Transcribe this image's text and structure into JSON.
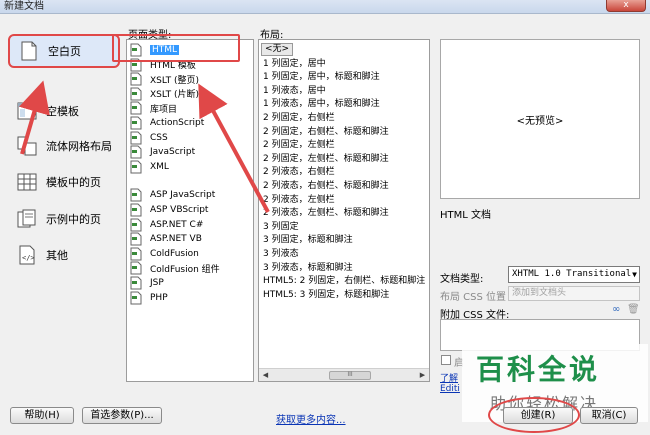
{
  "window": {
    "title": "新建文档",
    "close_label": "x"
  },
  "categories": [
    {
      "label": "空白页",
      "icon": "blank-page-icon",
      "selected": true
    },
    {
      "label": "空模板",
      "icon": "blank-template-icon",
      "selected": false
    },
    {
      "label": "流体网格布局",
      "icon": "fluid-grid-icon",
      "selected": false
    },
    {
      "label": "模板中的页",
      "icon": "page-from-template-icon",
      "selected": false
    },
    {
      "label": "示例中的页",
      "icon": "page-from-sample-icon",
      "selected": false
    },
    {
      "label": "其他",
      "icon": "other-icon",
      "selected": false
    }
  ],
  "page_type": {
    "label": "页面类型:",
    "items": [
      {
        "label": "HTML",
        "selected": true
      },
      {
        "label": "HTML 模板"
      },
      {
        "label": "XSLT (整页)"
      },
      {
        "label": "XSLT (片断)"
      },
      {
        "label": "库项目"
      },
      {
        "label": "ActionScript"
      },
      {
        "label": "CSS"
      },
      {
        "label": "JavaScript"
      },
      {
        "label": "XML"
      },
      {
        "label": "ASP JavaScript"
      },
      {
        "label": "ASP VBScript"
      },
      {
        "label": "ASP.NET C#"
      },
      {
        "label": "ASP.NET VB"
      },
      {
        "label": "ColdFusion"
      },
      {
        "label": "ColdFusion 组件"
      },
      {
        "label": "JSP"
      },
      {
        "label": "PHP"
      }
    ]
  },
  "layout": {
    "label": "布局:",
    "items": [
      "<无>",
      "1 列固定，居中",
      "1 列固定，居中，标题和脚注",
      "1 列液态，居中",
      "1 列液态，居中，标题和脚注",
      "2 列固定，右侧栏",
      "2 列固定，右侧栏、标题和脚注",
      "2 列固定，左侧栏",
      "2 列固定，左侧栏、标题和脚注",
      "2 列液态，右侧栏",
      "2 列液态，右侧栏、标题和脚注",
      "2 列液态，左侧栏",
      "2 列液态，左侧栏、标题和脚注",
      "3 列固定",
      "3 列固定，标题和脚注",
      "3 列液态",
      "3 列液态，标题和脚注",
      "HTML5: 2 列固定，右侧栏、标题和脚注",
      "HTML5: 3 列固定，标题和脚注"
    ],
    "selected_index": 0,
    "scroll_grip": "III"
  },
  "preview": {
    "placeholder": "<无预览>",
    "caption": "HTML 文档"
  },
  "doc_type": {
    "label": "文档类型:",
    "value": "XHTML 1.0 Transitional"
  },
  "layout_css": {
    "label": "布局 CSS 位置",
    "value": "添加到文档头"
  },
  "attach_css": {
    "label": "附加 CSS 文件:"
  },
  "enable": {
    "label": "启"
  },
  "learn_more": {
    "line1": "了解",
    "line2": "Editi"
  },
  "watermark": {
    "title": "百科全说",
    "subtitle": "助你轻松解决"
  },
  "buttons": {
    "help": "帮助(H)",
    "prefs": "首选参数(P)...",
    "more": "获取更多内容...",
    "create": "创建(R)",
    "cancel": "取消(C)"
  },
  "colors": {
    "annotation_red": "#e04848",
    "selection_blue": "#3399ff",
    "watermark_green": "#1e8f4a"
  }
}
